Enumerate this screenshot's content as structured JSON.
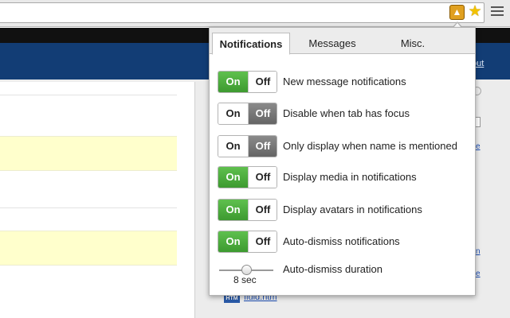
{
  "browser": {
    "extension_icon": "flame-extension-icon",
    "bookmark_icon": "star-icon",
    "menu_icon": "hamburger-menu-icon"
  },
  "page": {
    "header_link": "out",
    "links": [
      "e",
      "n",
      "e"
    ],
    "file_badge": "HTM",
    "file_link": "fluid.htm"
  },
  "popup": {
    "tabs": [
      {
        "label": "Notifications",
        "active": true
      },
      {
        "label": "Messages",
        "active": false
      },
      {
        "label": "Misc.",
        "active": false
      }
    ],
    "toggle_on_label": "On",
    "toggle_off_label": "Off",
    "settings": [
      {
        "label": "New message notifications",
        "state": "on"
      },
      {
        "label": "Disable when tab has focus",
        "state": "off"
      },
      {
        "label": "Only display when name is mentioned",
        "state": "off"
      },
      {
        "label": "Display media in notifications",
        "state": "on"
      },
      {
        "label": "Display avatars in notifications",
        "state": "on"
      },
      {
        "label": "Auto-dismiss notifications",
        "state": "on"
      }
    ],
    "slider": {
      "label": "Auto-dismiss duration",
      "value_text": "8 sec",
      "fraction": 0.45
    }
  },
  "colors": {
    "on_green": "#4caf3e",
    "off_gray": "#777777",
    "header_blue": "#123d75",
    "highlight_yellow": "#ffffcc"
  }
}
